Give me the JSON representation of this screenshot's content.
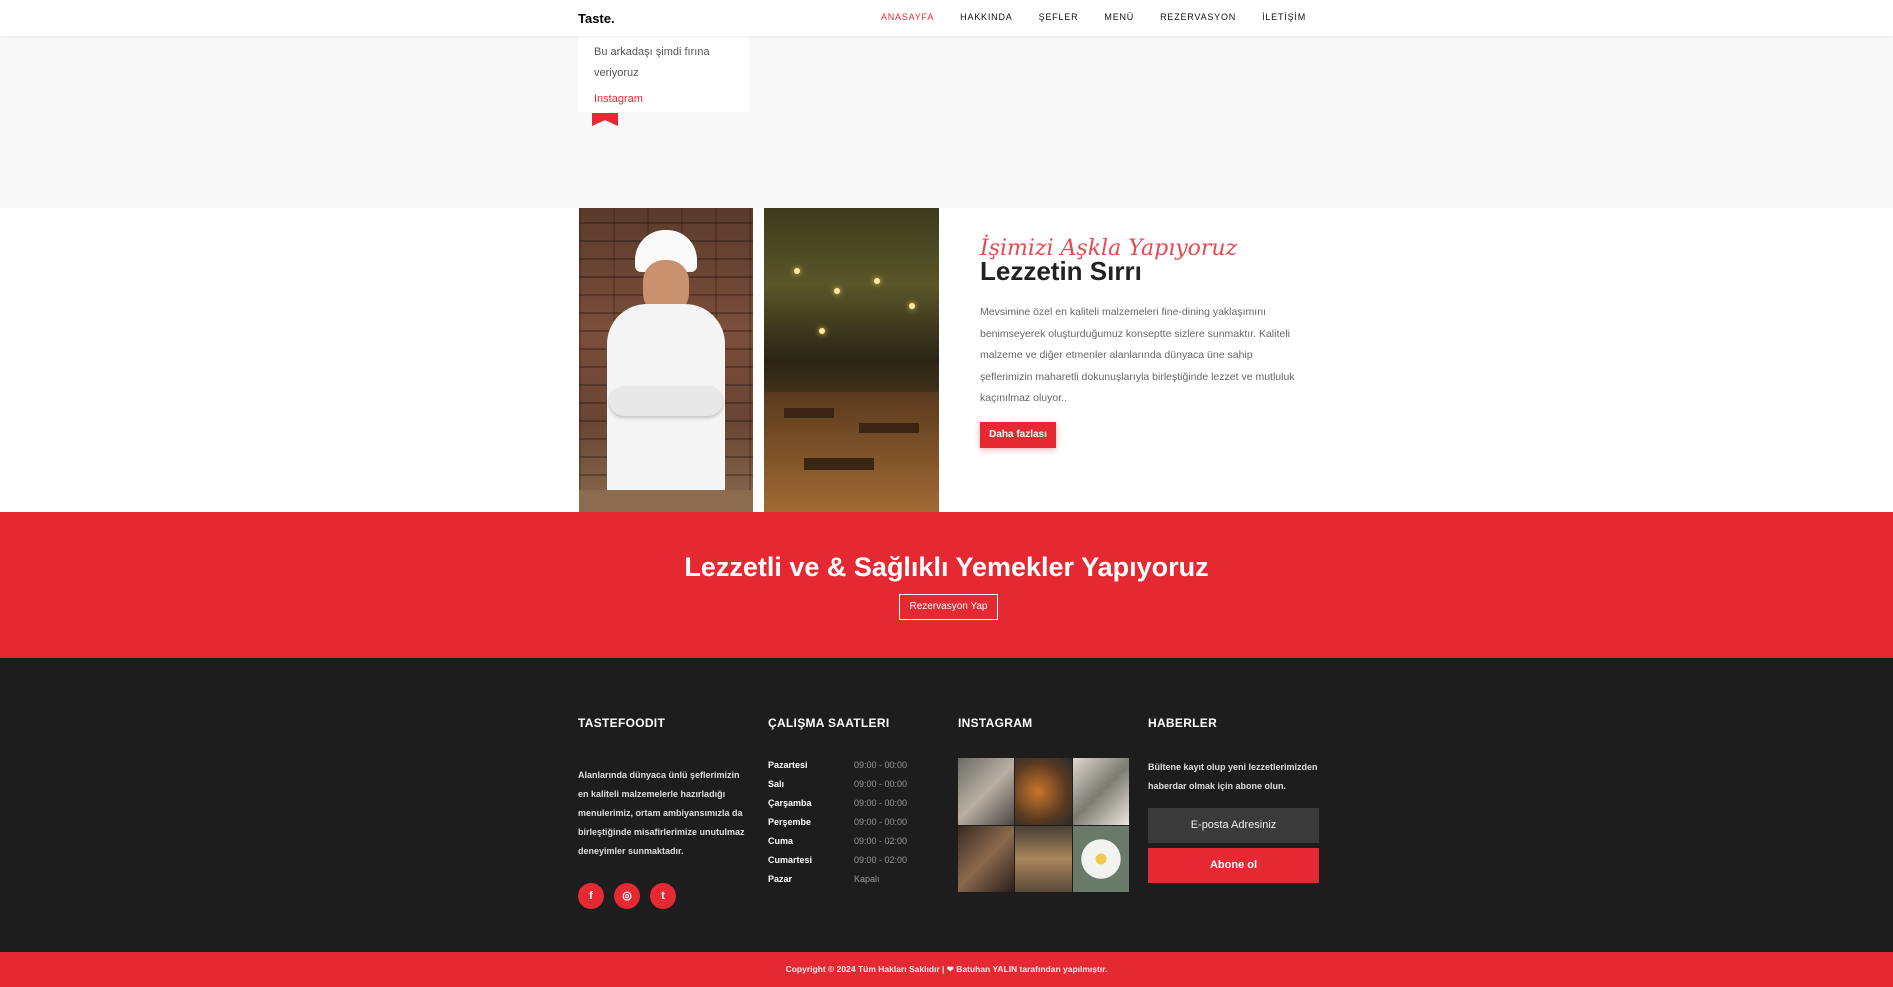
{
  "nav": {
    "brand": "Taste.",
    "items": [
      "ANASAYFA",
      "HAKKINDA",
      "ŞEFLER",
      "MENÜ",
      "REZERVASYON",
      "İLETİŞİM"
    ],
    "active": "ANASAYFA"
  },
  "card": {
    "text_line1": "Bu arkadaşı şimdi fırına",
    "text_line2": "veriyoruz",
    "link": "Instagram"
  },
  "about": {
    "script_title": "İşimizi Aşkla Yapıyoruz",
    "title": "Lezzetin Sırrı",
    "description": "Mevsimine özel en kaliteli malzemeleri fine-dining yaklaşımını benimseyerek oluşturduğumuz konseptte sizlere sunmaktır. Kaliteli malzeme ve diğer etmenler alanlarında dünyaca üne sahip şeflerimizin maharetli dokunuşlarıyla birleştiğinde lezzet ve mutluluk kaçınılmaz oluyor..",
    "button": "Daha fazlası"
  },
  "banner": {
    "title": "Lezzetli ve & Sağlıklı Yemekler Yapıyoruz",
    "button": "Rezervasyon Yap"
  },
  "footer": {
    "about": {
      "heading": "TASTEFOODIT",
      "text": "Alanlarında dünyaca ünlü şeflerimizin en kaliteli malzemelerle hazırladığı menulerimiz, ortam ambiyansımızla da birleştiğinde misafirlerimize unutulmaz deneyimler sunmaktadır.",
      "social": [
        "facebook-icon",
        "instagram-icon",
        "twitter-icon"
      ]
    },
    "hours": {
      "heading": "ÇALIŞMA SAATLERI",
      "rows": [
        {
          "day": "Pazartesi",
          "time": "09:00 - 00:00"
        },
        {
          "day": "Salı",
          "time": "09:00 - 00:00"
        },
        {
          "day": "Çarşamba",
          "time": "09:00 - 00:00"
        },
        {
          "day": "Perşembe",
          "time": "09:00 - 00:00"
        },
        {
          "day": "Cuma",
          "time": "09:00 - 02:00"
        },
        {
          "day": "Cumartesi",
          "time": "09:00 - 02:00"
        },
        {
          "day": "Pazar",
          "time": "Kapalı"
        }
      ]
    },
    "instagram": {
      "heading": "INSTAGRAM"
    },
    "news": {
      "heading": "HABERLER",
      "text": "Bültene kayıt olup yeni lezzetlerimizden haberdar olmak için abone olun.",
      "email_placeholder": "E-posta Adresiniz",
      "subscribe": "Abone ol"
    },
    "copyright": "Copyright © 2024 Tüm Hakları Saklıdır | ❤ Batuhan YALIN tarafından yapılmıştır."
  },
  "colors": {
    "accent": "#e52933",
    "footer_bg": "#1d1d1d",
    "grey_bg": "#f8f8f8"
  }
}
